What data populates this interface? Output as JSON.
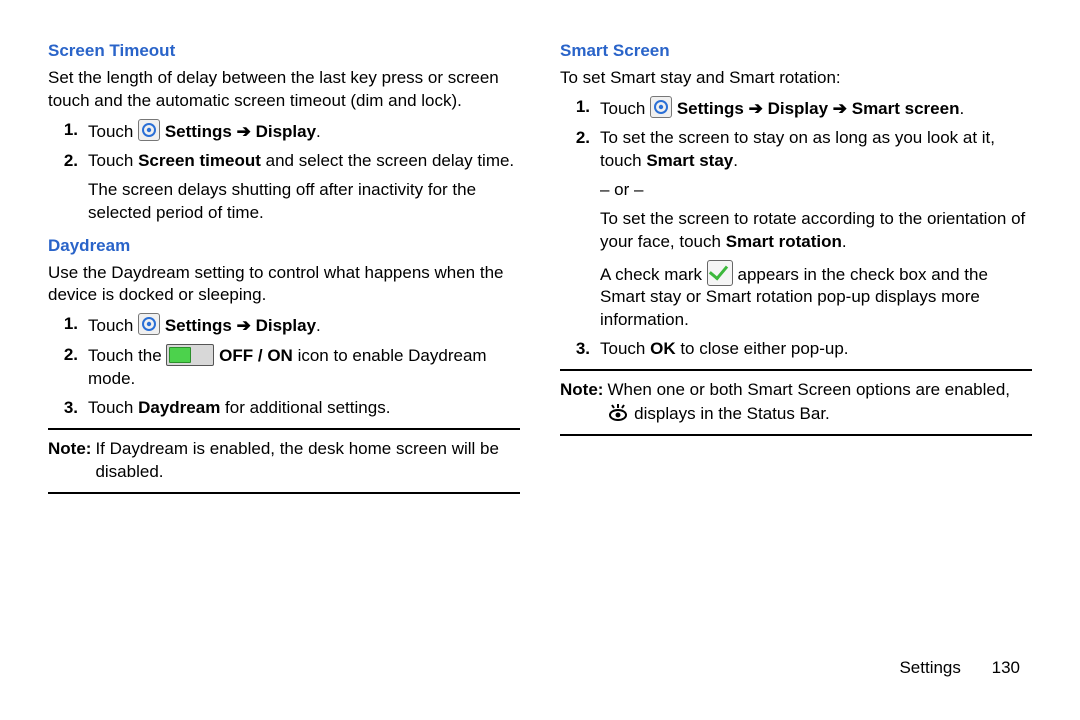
{
  "footer": {
    "section": "Settings",
    "page": "130"
  },
  "arrow": "➔",
  "or": "– or –",
  "col1": {
    "h1": "Screen Timeout",
    "p1": "Set the length of delay between the last key press or screen touch and the automatic screen timeout (dim and lock).",
    "s1_touch": "Touch ",
    "s1_path": " Settings ➔ Display",
    "s1_dot": ".",
    "s2_a": "Touch ",
    "s2_b": "Screen timeout",
    "s2_c": " and select the screen delay time.",
    "s2_extra": "The screen delays shutting off after inactivity for the selected period of time.",
    "h2": "Daydream",
    "p2": "Use the Daydream setting to control what happens when the device is docked or sleeping.",
    "d1_touch": "Touch ",
    "d1_path": " Settings ➔ Display",
    "d1_dot": ".",
    "d2_a": "Touch the ",
    "d2_b": " OFF / ON",
    "d2_c": " icon to enable Daydream mode.",
    "d3_a": "Touch ",
    "d3_b": "Daydream",
    "d3_c": " for additional settings.",
    "note_label": "Note:",
    "note_text": " If Daydream is enabled, the desk home screen will be disabled."
  },
  "col2": {
    "h1": "Smart Screen",
    "p1": "To set Smart stay and Smart rotation:",
    "s1_touch": "Touch ",
    "s1_path": " Settings ➔ Display ➔ Smart screen",
    "s1_dot": ".",
    "s2_a": "To set the screen to stay on as long as you look at it, touch ",
    "s2_b": "Smart stay",
    "s2_c": ".",
    "s2_alt_a": "To set the screen to rotate according to the orientation of your face, touch ",
    "s2_alt_b": "Smart rotation",
    "s2_alt_c": ".",
    "s2_check_a": "A check mark ",
    "s2_check_b": " appears in the check box and the Smart stay or Smart rotation pop-up displays more information.",
    "s3_a": "Touch ",
    "s3_b": "OK",
    "s3_c": " to close either pop-up.",
    "note_label": "Note:",
    "note_text_a": " When one or both Smart Screen options are enabled, ",
    "note_text_b": " displays in the Status Bar."
  }
}
